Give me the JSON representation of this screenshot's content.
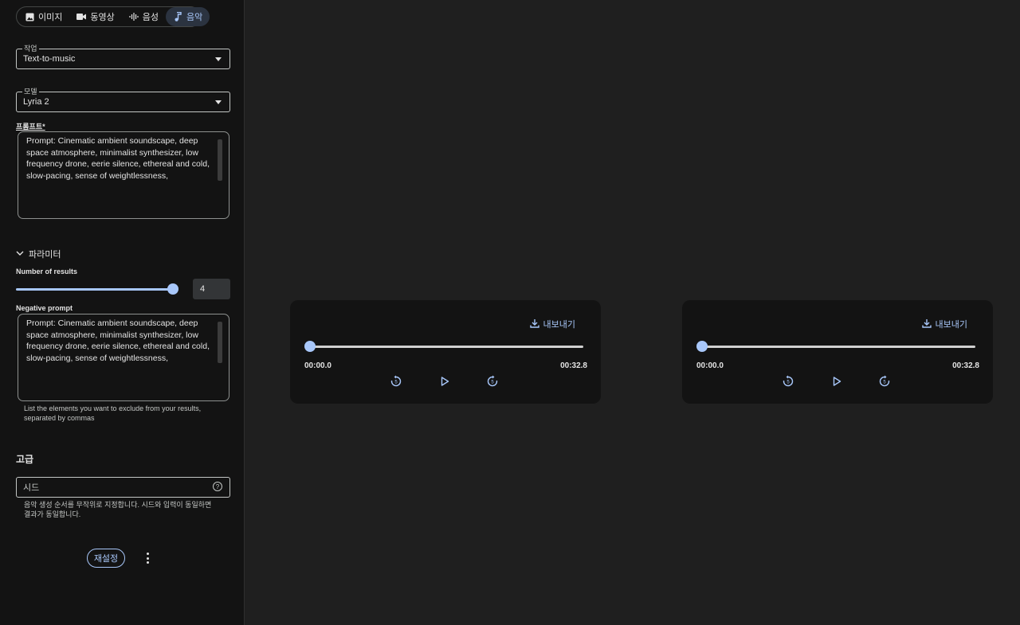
{
  "modes": [
    {
      "label": "이미지",
      "icon": "image-icon",
      "active": false
    },
    {
      "label": "동영상",
      "icon": "video-icon",
      "active": false
    },
    {
      "label": "음성",
      "icon": "audio-wave-icon",
      "active": false
    },
    {
      "label": "음악",
      "icon": "music-note-icon",
      "active": true
    }
  ],
  "task": {
    "label": "작업",
    "value": "Text-to-music"
  },
  "model": {
    "label": "모델",
    "value": "Lyria 2"
  },
  "prompt": {
    "label": "프롬프트*",
    "value": "Prompt: Cinematic ambient soundscape, deep space atmosphere, minimalist synthesizer, low frequency drone, eerie silence, ethereal and cold, slow-pacing, sense of weightlessness,"
  },
  "parameters": {
    "title": "파라미터",
    "number_of_results_label": "Number of results",
    "number_of_results": "4",
    "negative_prompt_label": "Negative prompt",
    "negative_prompt": "Prompt: Cinematic ambient soundscape, deep space atmosphere, minimalist synthesizer, low frequency drone, eerie silence, ethereal and cold, slow-pacing, sense of weightlessness,",
    "negative_help": "List the elements you want to exclude from your results, separated by commas"
  },
  "advanced": {
    "title": "고급",
    "seed_placeholder": "시드",
    "seed_help": "음악 생성 순서를 무작위로 지정합니다. 시드와 입력이 동일하면 결과가 동일합니다."
  },
  "reset_label": "재설정",
  "results": [
    {
      "export_label": "내보내기",
      "time_start": "00:00.0",
      "time_end": "00:32.8",
      "progress": 0
    },
    {
      "export_label": "내보내기",
      "time_start": "00:00.0",
      "time_end": "00:32.8",
      "progress": 0
    }
  ],
  "colors": {
    "accent": "#a8c7fa",
    "background": "#1f1f1f",
    "panel": "#131313"
  }
}
